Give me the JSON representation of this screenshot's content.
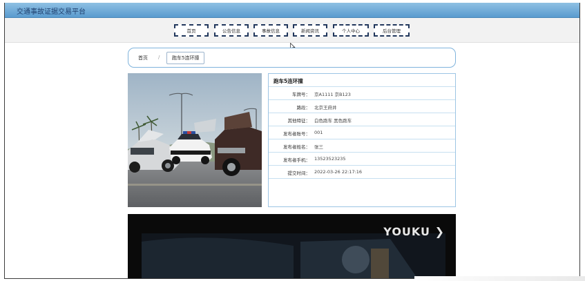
{
  "window": {
    "title": "交通事故证据交易平台"
  },
  "nav": {
    "items": [
      {
        "label": "首页"
      },
      {
        "label": "公告信息"
      },
      {
        "label": "事故信息"
      },
      {
        "label": "新闻资讯"
      },
      {
        "label": "个人中心"
      },
      {
        "label": "后台管理"
      }
    ]
  },
  "breadcrumb": {
    "home": "首页",
    "separator": "/",
    "current": "跑车5连环撞"
  },
  "detail": {
    "title": "跑车5连环撞",
    "rows": [
      {
        "label": "车牌号：",
        "value": "京A1111 京B123"
      },
      {
        "label": "路段：",
        "value": "北京王府井"
      },
      {
        "label": "其他特征：",
        "value": "白色跑车 黑色跑车"
      },
      {
        "label": "发布者账号：",
        "value": "001"
      },
      {
        "label": "发布者姓名：",
        "value": "张三"
      },
      {
        "label": "发布者手机：",
        "value": "13523523235"
      },
      {
        "label": "提交时间：",
        "value": "2022-03-26 22:17:16"
      }
    ]
  },
  "video": {
    "brand": "YOUKU ❯"
  },
  "colors": {
    "titlebar": "#6fa9d6",
    "accent": "#21375c",
    "border": "#9cc4e4"
  }
}
